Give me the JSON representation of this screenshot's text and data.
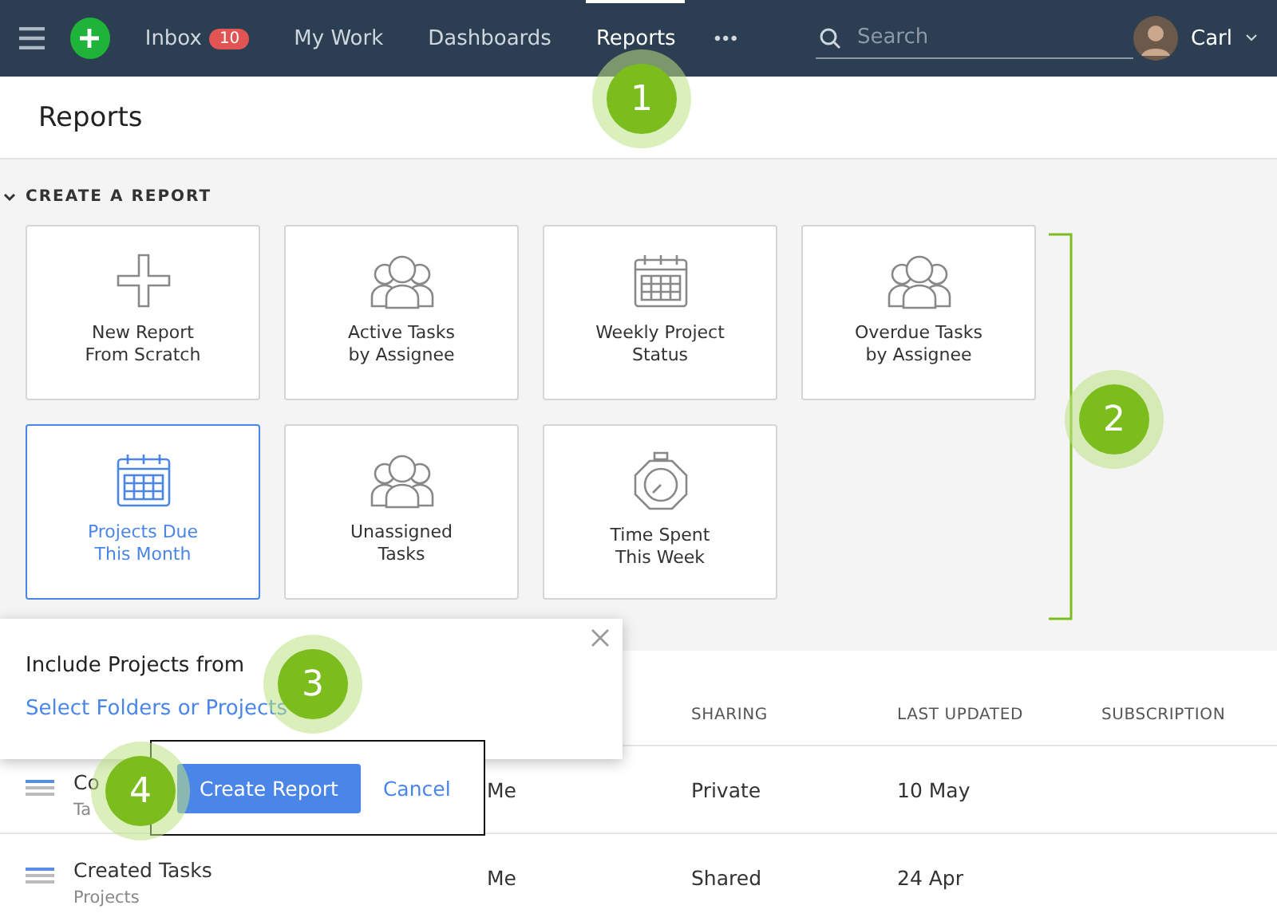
{
  "nav": {
    "items": [
      {
        "label": "Inbox",
        "badge": "10",
        "selected": false
      },
      {
        "label": "My Work",
        "selected": false
      },
      {
        "label": "Dashboards",
        "selected": false
      },
      {
        "label": "Reports",
        "selected": true
      }
    ],
    "more": "•••",
    "search": {
      "placeholder": "Search"
    },
    "user": {
      "name": "Carl"
    }
  },
  "page_title": "Reports",
  "create_section": {
    "title": "CREATE A REPORT",
    "expanded": true,
    "templates": [
      {
        "lines": [
          "New Report",
          "From Scratch"
        ],
        "kind": "plus",
        "selected": false
      },
      {
        "lines": [
          "Active Tasks",
          "by Assignee"
        ],
        "kind": "people",
        "selected": false
      },
      {
        "lines": [
          "Weekly Project",
          "Status"
        ],
        "kind": "calendar",
        "selected": false
      },
      {
        "lines": [
          "Overdue Tasks",
          "by Assignee"
        ],
        "kind": "people",
        "selected": false
      },
      {
        "lines": [
          "Projects Due",
          "This Month"
        ],
        "kind": "calendar",
        "selected": true
      },
      {
        "lines": [
          "Unassigned",
          "Tasks"
        ],
        "kind": "people",
        "selected": false
      },
      {
        "lines": [
          "Time Spent",
          "This Week"
        ],
        "kind": "stopwatch",
        "selected": false
      }
    ]
  },
  "popup": {
    "title": "Include Projects from",
    "link": "Select Folders or Projects",
    "primary": "Create Report",
    "cancel": "Cancel"
  },
  "table": {
    "columns": [
      "SHARING",
      "LAST UPDATED",
      "SUBSCRIPTION"
    ],
    "rows": [
      {
        "name": "Co",
        "sub": "Ta",
        "owner": "Me",
        "sharing": "Private",
        "updated": "10 May"
      },
      {
        "name": "Created Tasks",
        "sub": "Projects",
        "owner": "Me",
        "sharing": "Shared",
        "updated": "24 Apr"
      }
    ]
  },
  "annotations": [
    {
      "label": "1"
    },
    {
      "label": "2"
    },
    {
      "label": "3"
    },
    {
      "label": "4"
    }
  ]
}
